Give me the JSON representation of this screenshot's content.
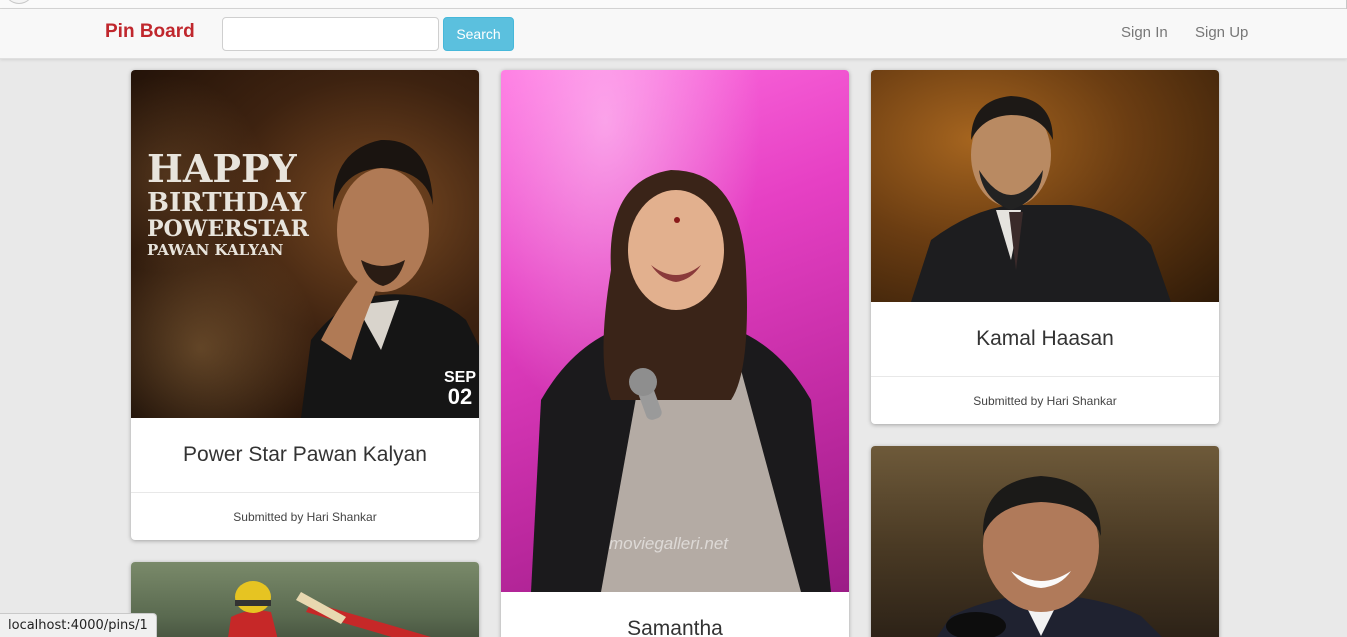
{
  "navbar": {
    "brand": "Pin Board",
    "search": {
      "placeholder": "",
      "value": "",
      "button_label": "Search"
    },
    "links": {
      "sign_in": "Sign In",
      "sign_up": "Sign Up"
    }
  },
  "pins": [
    {
      "title": "Power Star Pawan Kalyan",
      "submitted": "Submitted by Hari Shankar",
      "image_text": {
        "line1": "HAPPY",
        "line2": "BIRTHDAY",
        "line3": "POWERSTAR",
        "line4": "PAWAN KALYAN",
        "month": "SEP",
        "day": "02"
      }
    },
    {
      "title": "Samantha",
      "submitted": "",
      "image_text": {
        "watermark": "moviegalleri.net"
      }
    },
    {
      "title": "Kamal Haasan",
      "submitted": "Submitted by Hari Shankar"
    },
    {
      "title": "",
      "submitted": ""
    },
    {
      "title": "",
      "submitted": ""
    }
  ],
  "status_bar": {
    "url": "localhost:4000/pins/1"
  }
}
